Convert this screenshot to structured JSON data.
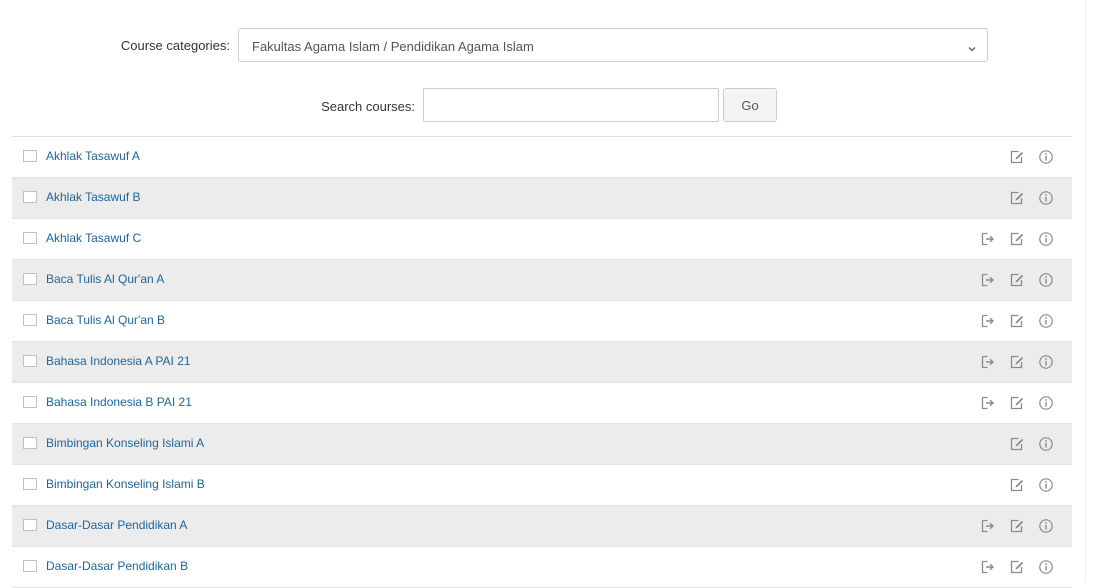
{
  "filters": {
    "category_label": "Course categories:",
    "category_value": "Fakultas Agama Islam / Pendidikan Agama Islam",
    "search_label": "Search courses:",
    "search_value": "",
    "search_placeholder": "",
    "go_label": "Go"
  },
  "colors": {
    "link": "#1f6599",
    "row_alt": "#ececec",
    "icon": "#8a8a8a"
  },
  "icons": {
    "enrol": "enrol-icon",
    "edit": "edit-icon",
    "info": "info-icon"
  },
  "courses": [
    {
      "name": "Akhlak Tasawuf A",
      "enrol_icon": false
    },
    {
      "name": "Akhlak Tasawuf B",
      "enrol_icon": false
    },
    {
      "name": "Akhlak Tasawuf C",
      "enrol_icon": true
    },
    {
      "name": "Baca Tulis Al Qur'an A",
      "enrol_icon": true
    },
    {
      "name": "Baca Tulis Al Qur'an B",
      "enrol_icon": true
    },
    {
      "name": "Bahasa Indonesia A PAI 21",
      "enrol_icon": true
    },
    {
      "name": "Bahasa Indonesia B PAI 21",
      "enrol_icon": true
    },
    {
      "name": "Bimbingan Konseling Islami A",
      "enrol_icon": false
    },
    {
      "name": "Bimbingan Konseling Islami B",
      "enrol_icon": false
    },
    {
      "name": "Dasar-Dasar Pendidikan A",
      "enrol_icon": true
    },
    {
      "name": "Dasar-Dasar Pendidikan B",
      "enrol_icon": true
    }
  ]
}
